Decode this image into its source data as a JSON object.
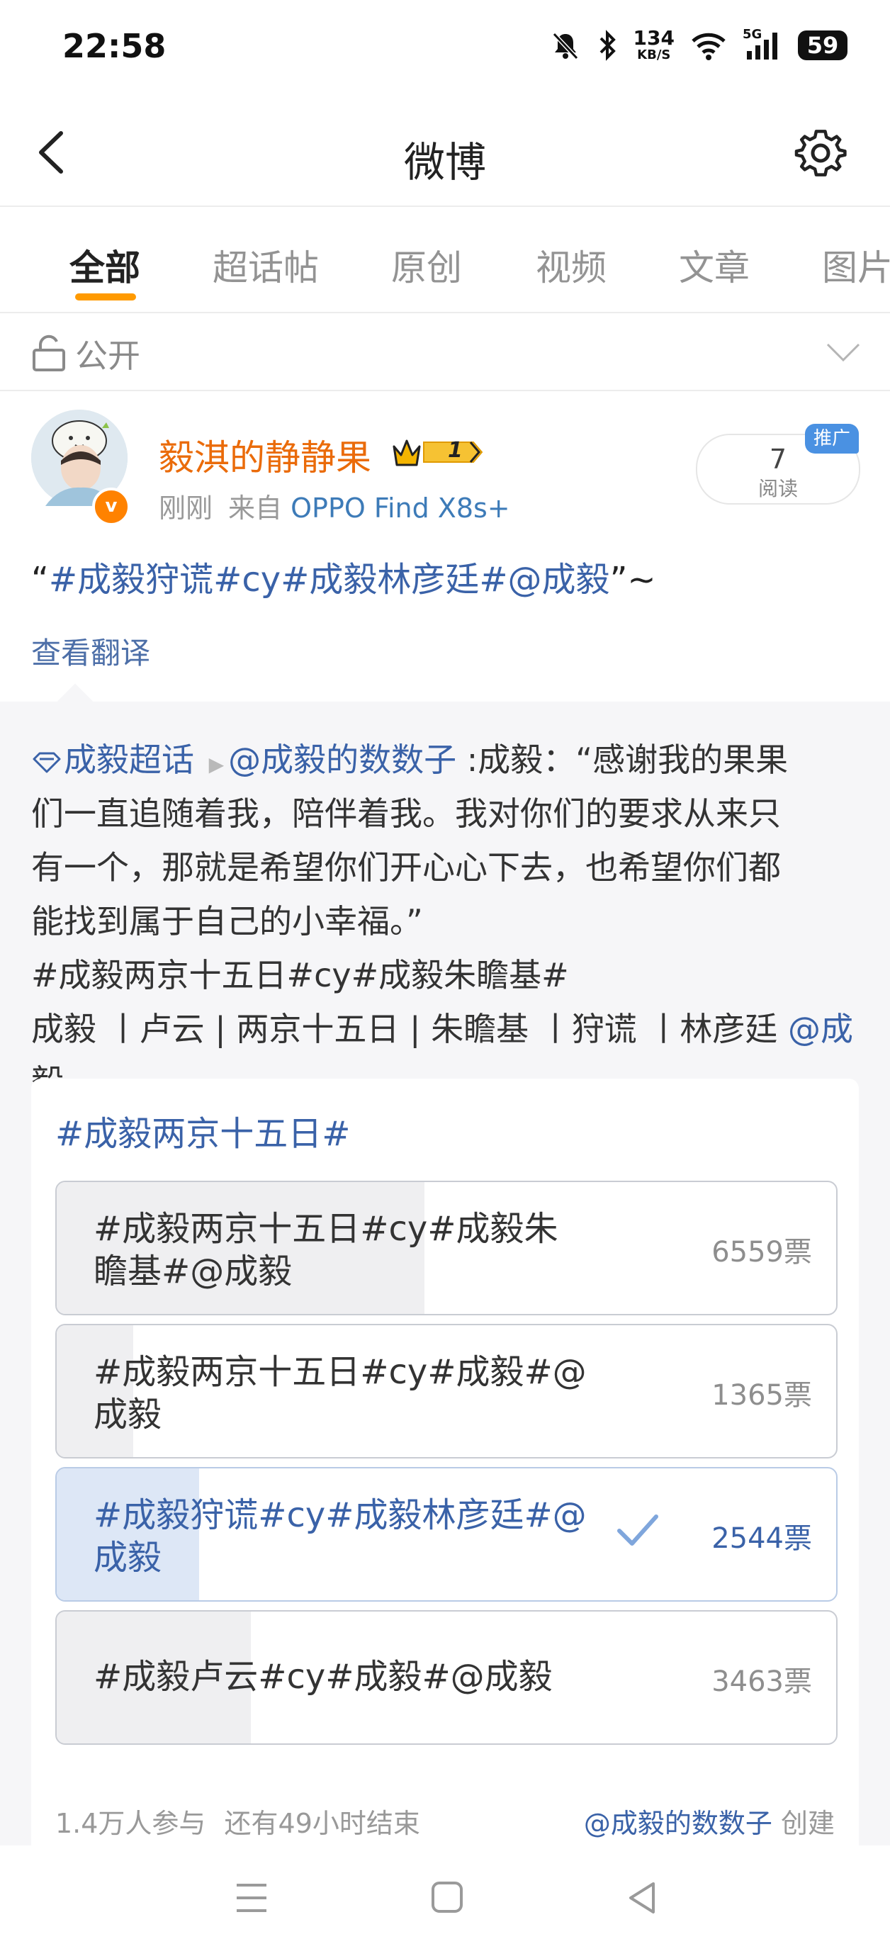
{
  "status_bar": {
    "time": "22:58",
    "net_speed_top": "134",
    "net_speed_unit": "KB/S",
    "signal": "5G",
    "battery": "59"
  },
  "header": {
    "title": "微博"
  },
  "tabs": [
    "全部",
    "超话帖",
    "原创",
    "视频",
    "文章",
    "图片"
  ],
  "active_tab": 0,
  "visibility": {
    "label": "公开"
  },
  "post": {
    "username": "毅淇的静静果",
    "vip_level": "1",
    "time": "刚刚",
    "source_prefix": "来自",
    "source_device": "OPPO Find X8s+",
    "read_count": "7",
    "read_label": "阅读",
    "promo_label": "推广",
    "text_open": "“",
    "text_link": "#成毅狩谎#cy#成毅林彦廷#@成毅",
    "text_close": "”~",
    "translate": "查看翻译"
  },
  "repost": {
    "topic": "成毅超话",
    "author": "@成毅的数数子",
    "line1_rest": " :成毅：“感谢我的果果",
    "line2": "们一直追随着我，陪伴着我。我对你们的要求从来只",
    "line3": "有一个，那就是希望你们开心心下去，也希望你们都",
    "line4": "能找到属于自己的小幸福。”",
    "line5_tags": "#成毅两京十五日#cy#成毅朱瞻基#",
    "line6_text": "成毅 丨卢云 | 两京十五日 | 朱瞻基 丨狩谎 丨林彦廷 ",
    "line6_link": "@成",
    "line7_link": "毅"
  },
  "poll": {
    "title": "#成毅两京十五日#",
    "options": [
      {
        "line1": "#成毅两京十五日#cy#成毅朱",
        "line2": "瞻基#@成毅",
        "votes": "6559票",
        "share": 0.472
      },
      {
        "line1": "#成毅两京十五日#cy#成毅#@",
        "line2": "成毅",
        "votes": "1365票",
        "share": 0.098
      },
      {
        "line1": "#成毅狩谎#cy#成毅林彦廷#@",
        "line2": "成毅",
        "votes": "2544票",
        "share": 0.183,
        "selected": true
      },
      {
        "line1": "#成毅卢云#cy#成毅#@成毅",
        "line2": "",
        "votes": "3463票",
        "share": 0.249
      }
    ],
    "participants": "1.4万人参与",
    "remaining": "还有49小时结束",
    "creator_link": "@成毅的数数子",
    "creator_suffix": " 创建"
  },
  "colors": {
    "accent": "#ff9a00",
    "link": "#3a62a8",
    "username": "#ea6b0a",
    "selected_bg": "#dde7f6"
  }
}
